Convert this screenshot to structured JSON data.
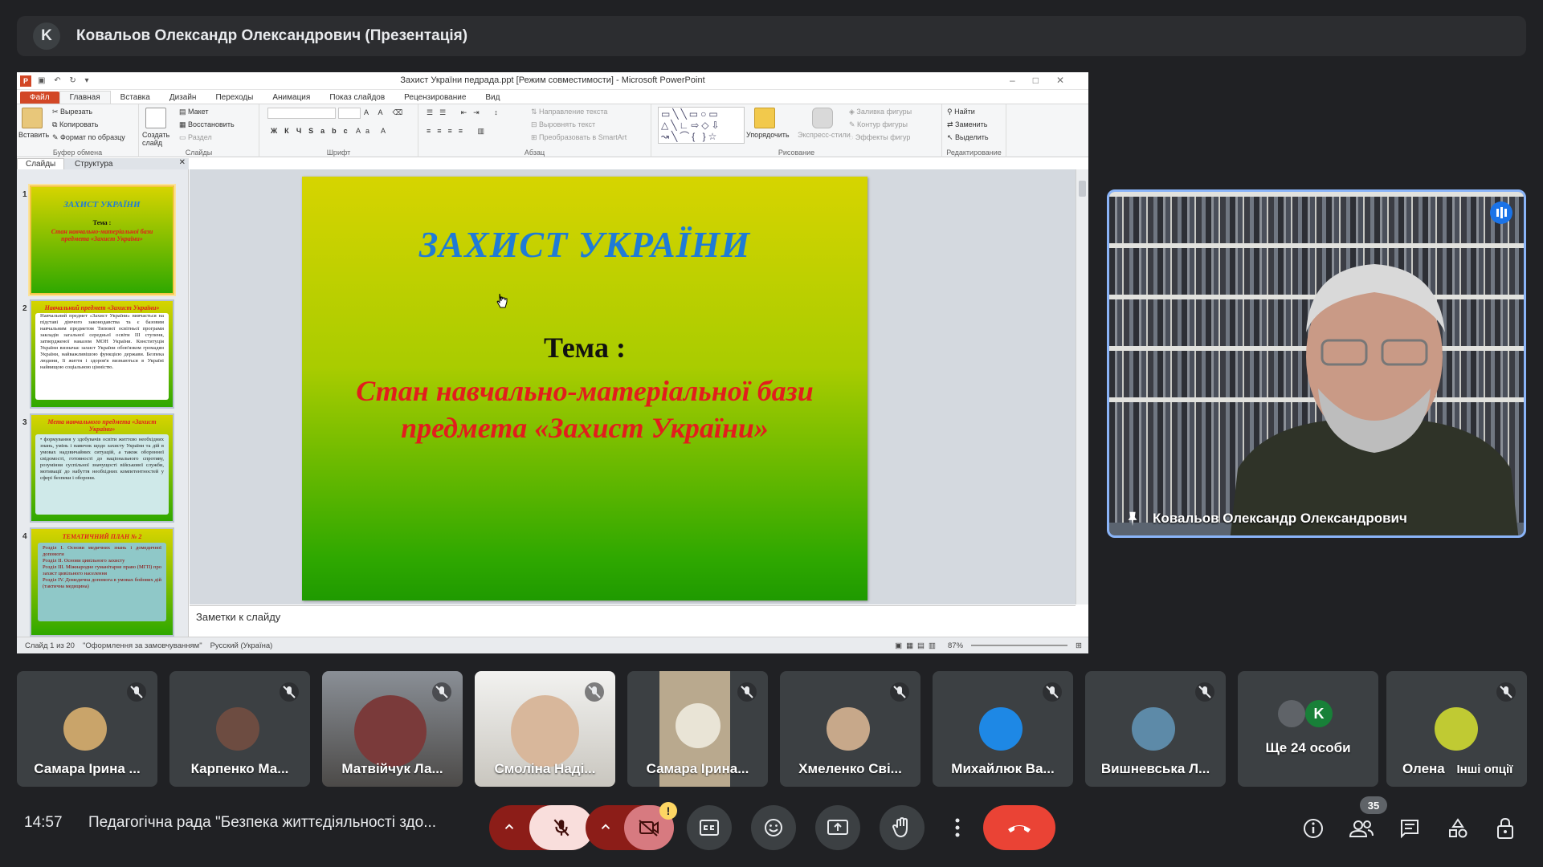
{
  "presenter_bar": {
    "avatar_letter": "K",
    "title": "Ковальов Олександр Олександрович (Презентація)"
  },
  "powerpoint": {
    "window_title": "Захист України педрада.ppt [Режим совместимости] - Microsoft PowerPoint",
    "ribbon_tabs": [
      "Файл",
      "Главная",
      "Вставка",
      "Дизайн",
      "Переходы",
      "Анимация",
      "Показ слайдов",
      "Рецензирование",
      "Вид"
    ],
    "clipboard": {
      "paste": "Вставить",
      "cut": "Вырезать",
      "copy": "Копировать",
      "format_painter": "Формат по образцу",
      "label": "Буфер обмена"
    },
    "slides_group": {
      "new_slide": "Создать слайд",
      "layout": "Макет",
      "reset": "Восстановить",
      "section": "Раздел",
      "label": "Слайды"
    },
    "font_group_label": "Шрифт",
    "paragraph": {
      "text_direction": "Направление текста",
      "align_text": "Выровнять текст",
      "smartart": "Преобразовать в SmartArt",
      "label": "Абзац"
    },
    "drawing": {
      "arrange": "Упорядочить",
      "quick_styles": "Экспресс-стили",
      "shape_fill": "Заливка фигуры",
      "shape_outline": "Контур фигуры",
      "shape_effects": "Эффекты фигур",
      "label": "Рисование"
    },
    "editing": {
      "find": "Найти",
      "replace": "Заменить",
      "select": "Выделить",
      "label": "Редактирование"
    },
    "pane_tabs": [
      "Слайды",
      "Структура"
    ],
    "thumbnails": [
      {
        "num": "1",
        "title": "ЗАХИСТ УКРАЇНИ",
        "line1": "Тема :",
        "line2": "Стан навчально-матеріальної бази предмета «Захист України»"
      },
      {
        "num": "2",
        "title": "Навчальний предмет «Захист України»",
        "body": "Навчальний предмет «Захист України» вивчається на підставі діючого законодавства та є базовим навчальним предметом Типової освітньої програми закладів загальної середньої освіти III ступеня, затвердженої наказом МОН України. Конституція України визначає захист України обов'язком громадян України, найважливішою функцією держави. Безпека людини, її життя і здоров'я визнаються в Україні найвищою соціальною цінністю."
      },
      {
        "num": "3",
        "title": "Мета навчального предмета «Захист України»",
        "body": "• формування у здобувачів освіти життєво необхідних знань, умінь і навичок щодо захисту України та дій в умовах надзвичайних ситуацій, а також оборонної свідомості, готовності до національного спротиву, розуміння суспільної значущості військової служби, мотивації до набуття необхідних компетентностей у сфері безпеки і оборони."
      },
      {
        "num": "4",
        "title": "ТЕМАТИЧНИЙ ПЛАН № 2",
        "items": [
          "Розділ I. Основи медичних знань і домедичної допомоги",
          "Розділ II. Основи цивільного захисту",
          "Розділ III. Міжнародне гуманітарне право (МГП) про захист цивільного населення",
          "Розділ IV. Домедична допомога в умовах бойових дій (тактична медицина)"
        ]
      }
    ],
    "slide": {
      "title": "ЗАХИСТ УКРАЇНИ",
      "tema": "Тема :",
      "subtitle_line1": "Стан навчально-матеріальної бази",
      "subtitle_line2": "предмета  «Захист України»"
    },
    "notes_placeholder": "Заметки к слайду",
    "status": {
      "slide_count": "Слайд 1 из 20",
      "theme": "\"Оформлення за замовчуванням\"",
      "language": "Русский (Україна)",
      "zoom": "87%"
    }
  },
  "pinned_tile": {
    "name": "Ковальов Олександр Олександрович"
  },
  "participants": [
    {
      "name": "Самара Ірина ...",
      "color": "#c9a46a"
    },
    {
      "name": "Карпенко Ма...",
      "color": "#6d4c41"
    },
    {
      "name": "Матвійчук Ла...",
      "color": "#7a6a5a"
    },
    {
      "name": "Смоліна Наді...",
      "color": "#b89a80"
    },
    {
      "name": "Самара Ірина...",
      "color": "#9a8d7a"
    },
    {
      "name": "Хмеленко Сві...",
      "color": "#c7a88a"
    },
    {
      "name": "Михайлюк Ва...",
      "color": "#1e88e5"
    },
    {
      "name": "Вишневська Л...",
      "color": "#5d8aa8"
    },
    {
      "name": "Ще 24 особи",
      "color": "#5f6368"
    },
    {
      "name": "Олена",
      "color": "#c0ca33"
    }
  ],
  "more_options": "Інші опції",
  "others_avatar_letter": "K",
  "bottom_bar": {
    "time": "14:57",
    "meeting_title": "Педагогічна рада \"Безпека життєдіяльності здо...",
    "people_count": "35",
    "camera_warning": "!"
  },
  "colors": {
    "accent_blue": "#8ab4f8",
    "end_call_red": "#ea4335"
  }
}
